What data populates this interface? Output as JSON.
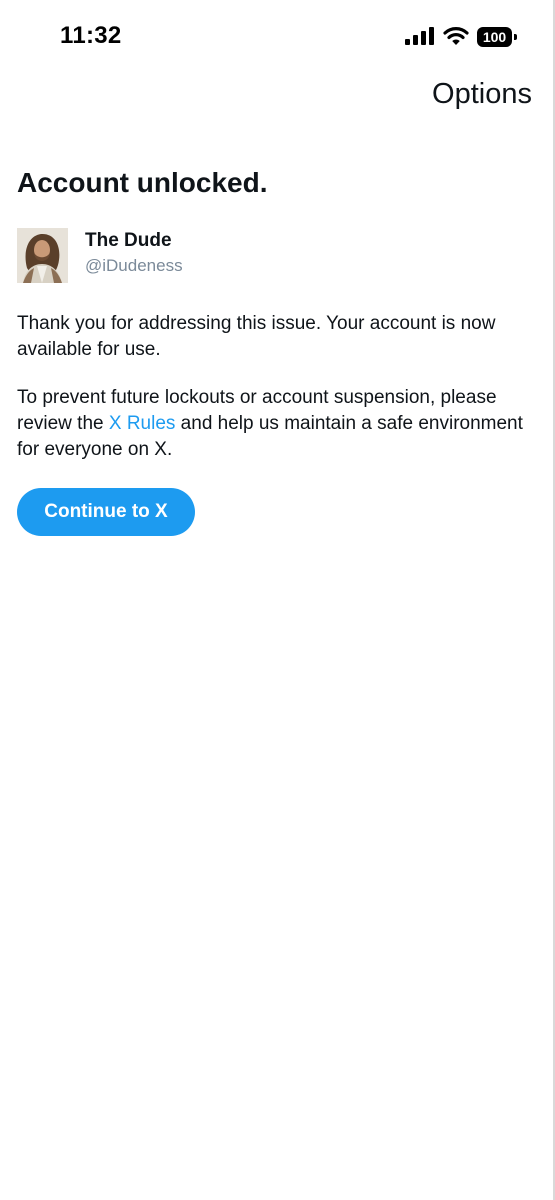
{
  "status_bar": {
    "time": "11:32",
    "battery": "100",
    "icons": [
      "signal-icon",
      "wifi-icon",
      "battery-icon"
    ]
  },
  "header": {
    "options_label": "Options"
  },
  "main": {
    "title": "Account unlocked.",
    "user": {
      "name": "The Dude",
      "handle": "@iDudeness"
    },
    "message1": "Thank you for addressing this issue. Your account is now available for use.",
    "message2": {
      "before": "To prevent future lockouts or account suspension, please review the ",
      "link": "X Rules",
      "after": " and help us maintain a safe environment for everyone on X."
    },
    "continue_label": "Continue to X"
  },
  "colors": {
    "accent": "#1d9bf0",
    "text": "#0f1419",
    "secondary_text": "#7b8a99",
    "background": "#ffffff"
  }
}
